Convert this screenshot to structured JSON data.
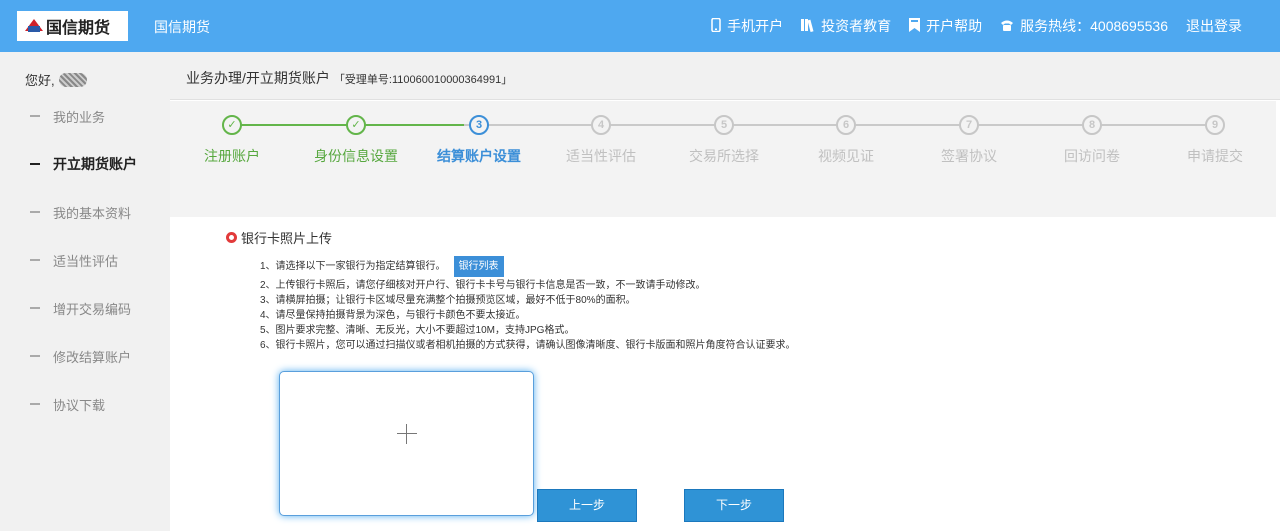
{
  "header": {
    "logo_text": "国信期货",
    "brand": "国信期货",
    "nav": [
      {
        "icon": "phone-icon",
        "label": "手机开户"
      },
      {
        "icon": "books-icon",
        "label": "投资者教育"
      },
      {
        "icon": "bookmark-icon",
        "label": "开户帮助"
      },
      {
        "icon": "telephone-icon",
        "label": "服务热线：4008695536"
      }
    ],
    "logout": "退出登录"
  },
  "sidebar": {
    "greeting": "您好,",
    "items": [
      {
        "label": "我的业务",
        "active": false
      },
      {
        "label": "开立期货账户",
        "active": true
      },
      {
        "label": "我的基本资料",
        "active": false
      },
      {
        "label": "适当性评估",
        "active": false
      },
      {
        "label": "增开交易编码",
        "active": false
      },
      {
        "label": "修改结算账户",
        "active": false
      },
      {
        "label": "协议下载",
        "active": false
      }
    ]
  },
  "breadcrumb": {
    "path": "业务办理/开立期货账户",
    "order": "「受理单号:110060010000364991」"
  },
  "steps": [
    {
      "num": "✓",
      "label": "注册账户",
      "state": "done"
    },
    {
      "num": "✓",
      "label": "身份信息设置",
      "state": "done"
    },
    {
      "num": "3",
      "label": "结算账户设置",
      "state": "current"
    },
    {
      "num": "4",
      "label": "适当性评估",
      "state": "pending"
    },
    {
      "num": "5",
      "label": "交易所选择",
      "state": "pending"
    },
    {
      "num": "6",
      "label": "视频见证",
      "state": "pending"
    },
    {
      "num": "7",
      "label": "签署协议",
      "state": "pending"
    },
    {
      "num": "8",
      "label": "回访问卷",
      "state": "pending"
    },
    {
      "num": "9",
      "label": "申请提交",
      "state": "pending"
    }
  ],
  "section": {
    "title": "银行卡照片上传",
    "instructions": [
      "1、请选择以下一家银行为指定结算银行。",
      "2、上传银行卡照后，请您仔细核对开户行、银行卡卡号与银行卡信息是否一致，不一致请手动修改。",
      "3、请横屏拍摄；让银行卡区域尽量充满整个拍摄预览区域，最好不低于80%的面积。",
      "4、请尽量保持拍摄背景为深色，与银行卡颜色不要太接近。",
      "5、图片要求完整、清晰、无反光，大小不要超过10M，支持JPG格式。",
      "6、银行卡照片，您可以通过扫描仪或者相机拍摄的方式获得，请确认图像清晰度、银行卡版面和照片角度符合认证要求。"
    ],
    "bank_list_button": "银行列表"
  },
  "buttons": {
    "prev": "上一步",
    "next": "下一步"
  },
  "colors": {
    "header": "#4ea8f0",
    "done": "#63b54a",
    "current": "#3c8fd8",
    "button": "#2f93d6"
  }
}
